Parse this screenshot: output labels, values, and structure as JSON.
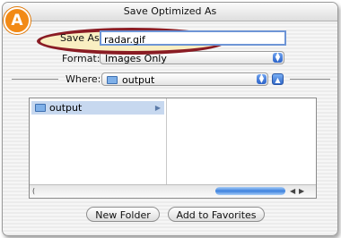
{
  "dialog": {
    "title": "Save Optimized As"
  },
  "badge": {
    "letter": "A",
    "color": "#f28a16"
  },
  "save_as": {
    "label": "Save As:",
    "value": "radar.gif"
  },
  "format": {
    "label": "Format:",
    "value": "Images Only"
  },
  "where": {
    "label": "Where:",
    "value": "output"
  },
  "browser": {
    "columns": [
      {
        "items": [
          {
            "label": "output",
            "selected": true
          }
        ]
      }
    ]
  },
  "buttons": {
    "new_folder": "New Folder",
    "add_favorites": "Add to Favorites"
  },
  "colors": {
    "highlight_oval": "#8a1c24",
    "selection": "#c7d8ef",
    "accent": "#2f66c8"
  }
}
